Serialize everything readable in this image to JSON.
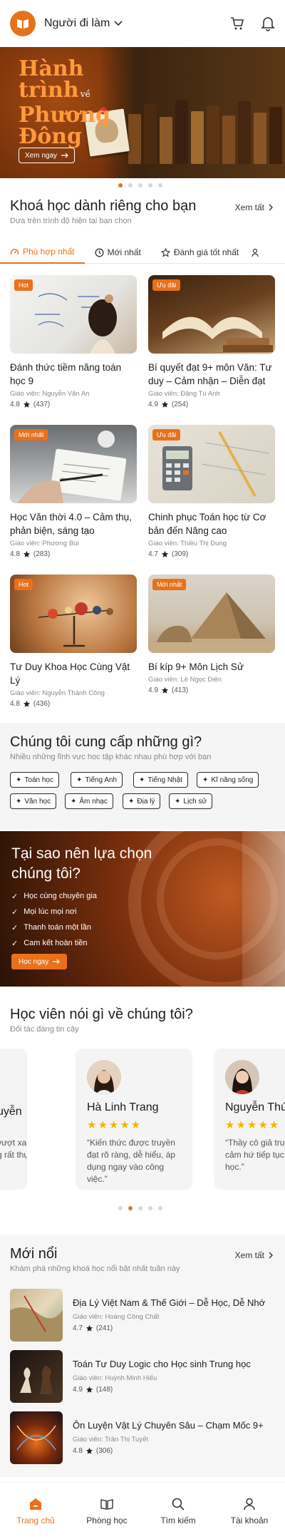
{
  "header": {
    "role": "Người đi làm"
  },
  "hero": {
    "title_lines": [
      "Hành",
      "trình",
      "Phương",
      "Đông"
    ],
    "title_small": "về",
    "button": "Xem ngay"
  },
  "featured": {
    "title": "Khoá học dành riêng cho bạn",
    "subtitle": "Dựa trên trình độ hiện tại bạn chọn",
    "see_all": "Xem tất",
    "tabs": [
      "Phù hợp nhất",
      "Mới nhất",
      "Đánh giá tốt nhất"
    ],
    "courses": [
      {
        "badge": "Hot",
        "title": "Đánh thức tiềm năng toán học 9",
        "teacher": "Giáo viên: Nguyễn Văn An",
        "rating": "4.8",
        "count": "(437)"
      },
      {
        "badge": "Ưu đãi",
        "title": "Bí quyết đạt 9+ môn Văn: Tư duy – Cảm nhận – Diễn đạt",
        "teacher": "Giáo viên: Đặng Tú Anh",
        "rating": "4.9",
        "count": "(254)"
      },
      {
        "badge": "Mới nhất",
        "title": "Học Văn thời 4.0 – Cảm thụ, phản biện, sáng tạo",
        "teacher": "Giáo viên: Phương Bùi",
        "rating": "4.8",
        "count": "(283)"
      },
      {
        "badge": "Ưu đãi",
        "title": "Chinh phục Toán học từ Cơ bản đến Nâng cao",
        "teacher": "Giáo viên: Thiều Thị Dung",
        "rating": "4.7",
        "count": "(309)"
      },
      {
        "badge": "Hot",
        "title": "Tư Duy Khoa Học Cùng Vật Lý",
        "teacher": "Giáo viên: Nguyễn Thành Công",
        "rating": "4.8",
        "count": "(436)"
      },
      {
        "badge": "Mới nhất",
        "title": "Bí kíp 9+ Môn Lịch Sử",
        "teacher": "Giáo viên: Lê Ngọc Diên",
        "rating": "4.9",
        "count": "(413)"
      }
    ]
  },
  "offer": {
    "title": "Chúng tôi cung cấp những gì?",
    "subtitle": "Nhiều những lĩnh vực học tập khác nhau phù hợp với bạn",
    "chips": [
      "Toán học",
      "Tiếng Anh",
      "Tiếng Nhật",
      "Kĩ năng sống",
      "Văn học",
      "Âm nhạc",
      "Địa lý",
      "Lịch sử"
    ]
  },
  "why": {
    "title_line1": "Tại sao nên lựa chọn",
    "title_line2": "chúng tôi?",
    "points": [
      "Học cùng chuyên gia",
      "Mọi lúc mọi nơi",
      "Thanh toán một lần",
      "Cam kết hoàn tiền"
    ],
    "button": "Học ngay"
  },
  "testimonials": {
    "title": "Học viên nói gì về chúng tôi?",
    "subtitle": "Đối tác đáng tin cậy",
    "items": [
      {
        "name": "uyễn",
        "quote": "vượt xa mong g rất thực tế"
      },
      {
        "name": "Hà Linh Trang",
        "quote": "“Kiến thức được truyền đạt rõ ràng, dễ hiểu, áp dụng ngay vào công việc.”"
      },
      {
        "name": "Nguyễn Thú",
        "quote": "“Thầy cô giả truyền cảm hứ tiếp tục học.”"
      }
    ]
  },
  "new": {
    "title": "Mới nổi",
    "subtitle": "Khám phá những khoá học nổi bật nhất tuần này",
    "see_all": "Xem tất",
    "items": [
      {
        "title": "Địa Lý Việt Nam & Thế Giới – Dễ Học, Dễ Nhớ",
        "teacher": "Giáo viên: Hoàng Công Chất",
        "rating": "4.7",
        "count": "(241)"
      },
      {
        "title": "Toán Tư Duy Logic cho Học sinh Trung học",
        "teacher": "Giáo viên: Huỳnh Minh Hiếu",
        "rating": "4.9",
        "count": "(148)"
      },
      {
        "title": "Ôn Luyện Vật Lý Chuyên Sâu – Chạm Mốc 9+",
        "teacher": "Giáo viên: Trần Thị Tuyết",
        "rating": "4.8",
        "count": "(306)"
      }
    ]
  },
  "nav": {
    "items": [
      "Trang chủ",
      "Phòng học",
      "Tìm kiếm",
      "Tài khoản"
    ]
  },
  "colors": {
    "accent": "#e8711c"
  }
}
